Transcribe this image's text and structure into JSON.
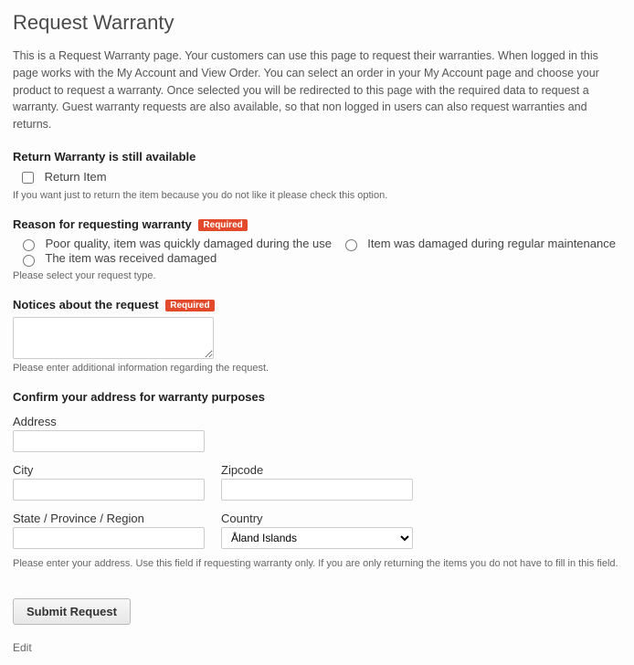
{
  "page": {
    "title": "Request Warranty",
    "intro": "This is a Request Warranty page. Your customers can use this page to request their warranties. When logged in this page works with the My Account and View Order. You can select an order in your My Account page and choose your product to request a warranty. Once selected you will be redirected to this page with the required data to request a warranty. Guest warranty requests are also available, so that non logged in users can also request warranties and returns."
  },
  "return_section": {
    "heading": "Return Warranty is still available",
    "checkbox_label": "Return Item",
    "helper": "If you want just to return the item because you do not like it please check this option."
  },
  "reason_section": {
    "heading": "Reason for requesting warranty",
    "required": "Required",
    "options": [
      "Poor quality, item was quickly damaged during the use",
      "Item was damaged during regular maintenance",
      "The item was received damaged"
    ],
    "helper": "Please select your request type."
  },
  "notices_section": {
    "heading": "Notices about the request",
    "required": "Required",
    "helper": "Please enter additional information regarding the request."
  },
  "address_section": {
    "heading": "Confirm your address for warranty purposes",
    "address_label": "Address",
    "city_label": "City",
    "zipcode_label": "Zipcode",
    "state_label": "State / Province / Region",
    "country_label": "Country",
    "country_selected": "Åland Islands",
    "helper": "Please enter your address. Use this field if requesting warranty only. If you are only returning the items you do not have to fill in this field."
  },
  "actions": {
    "submit": "Submit Request",
    "edit": "Edit"
  }
}
